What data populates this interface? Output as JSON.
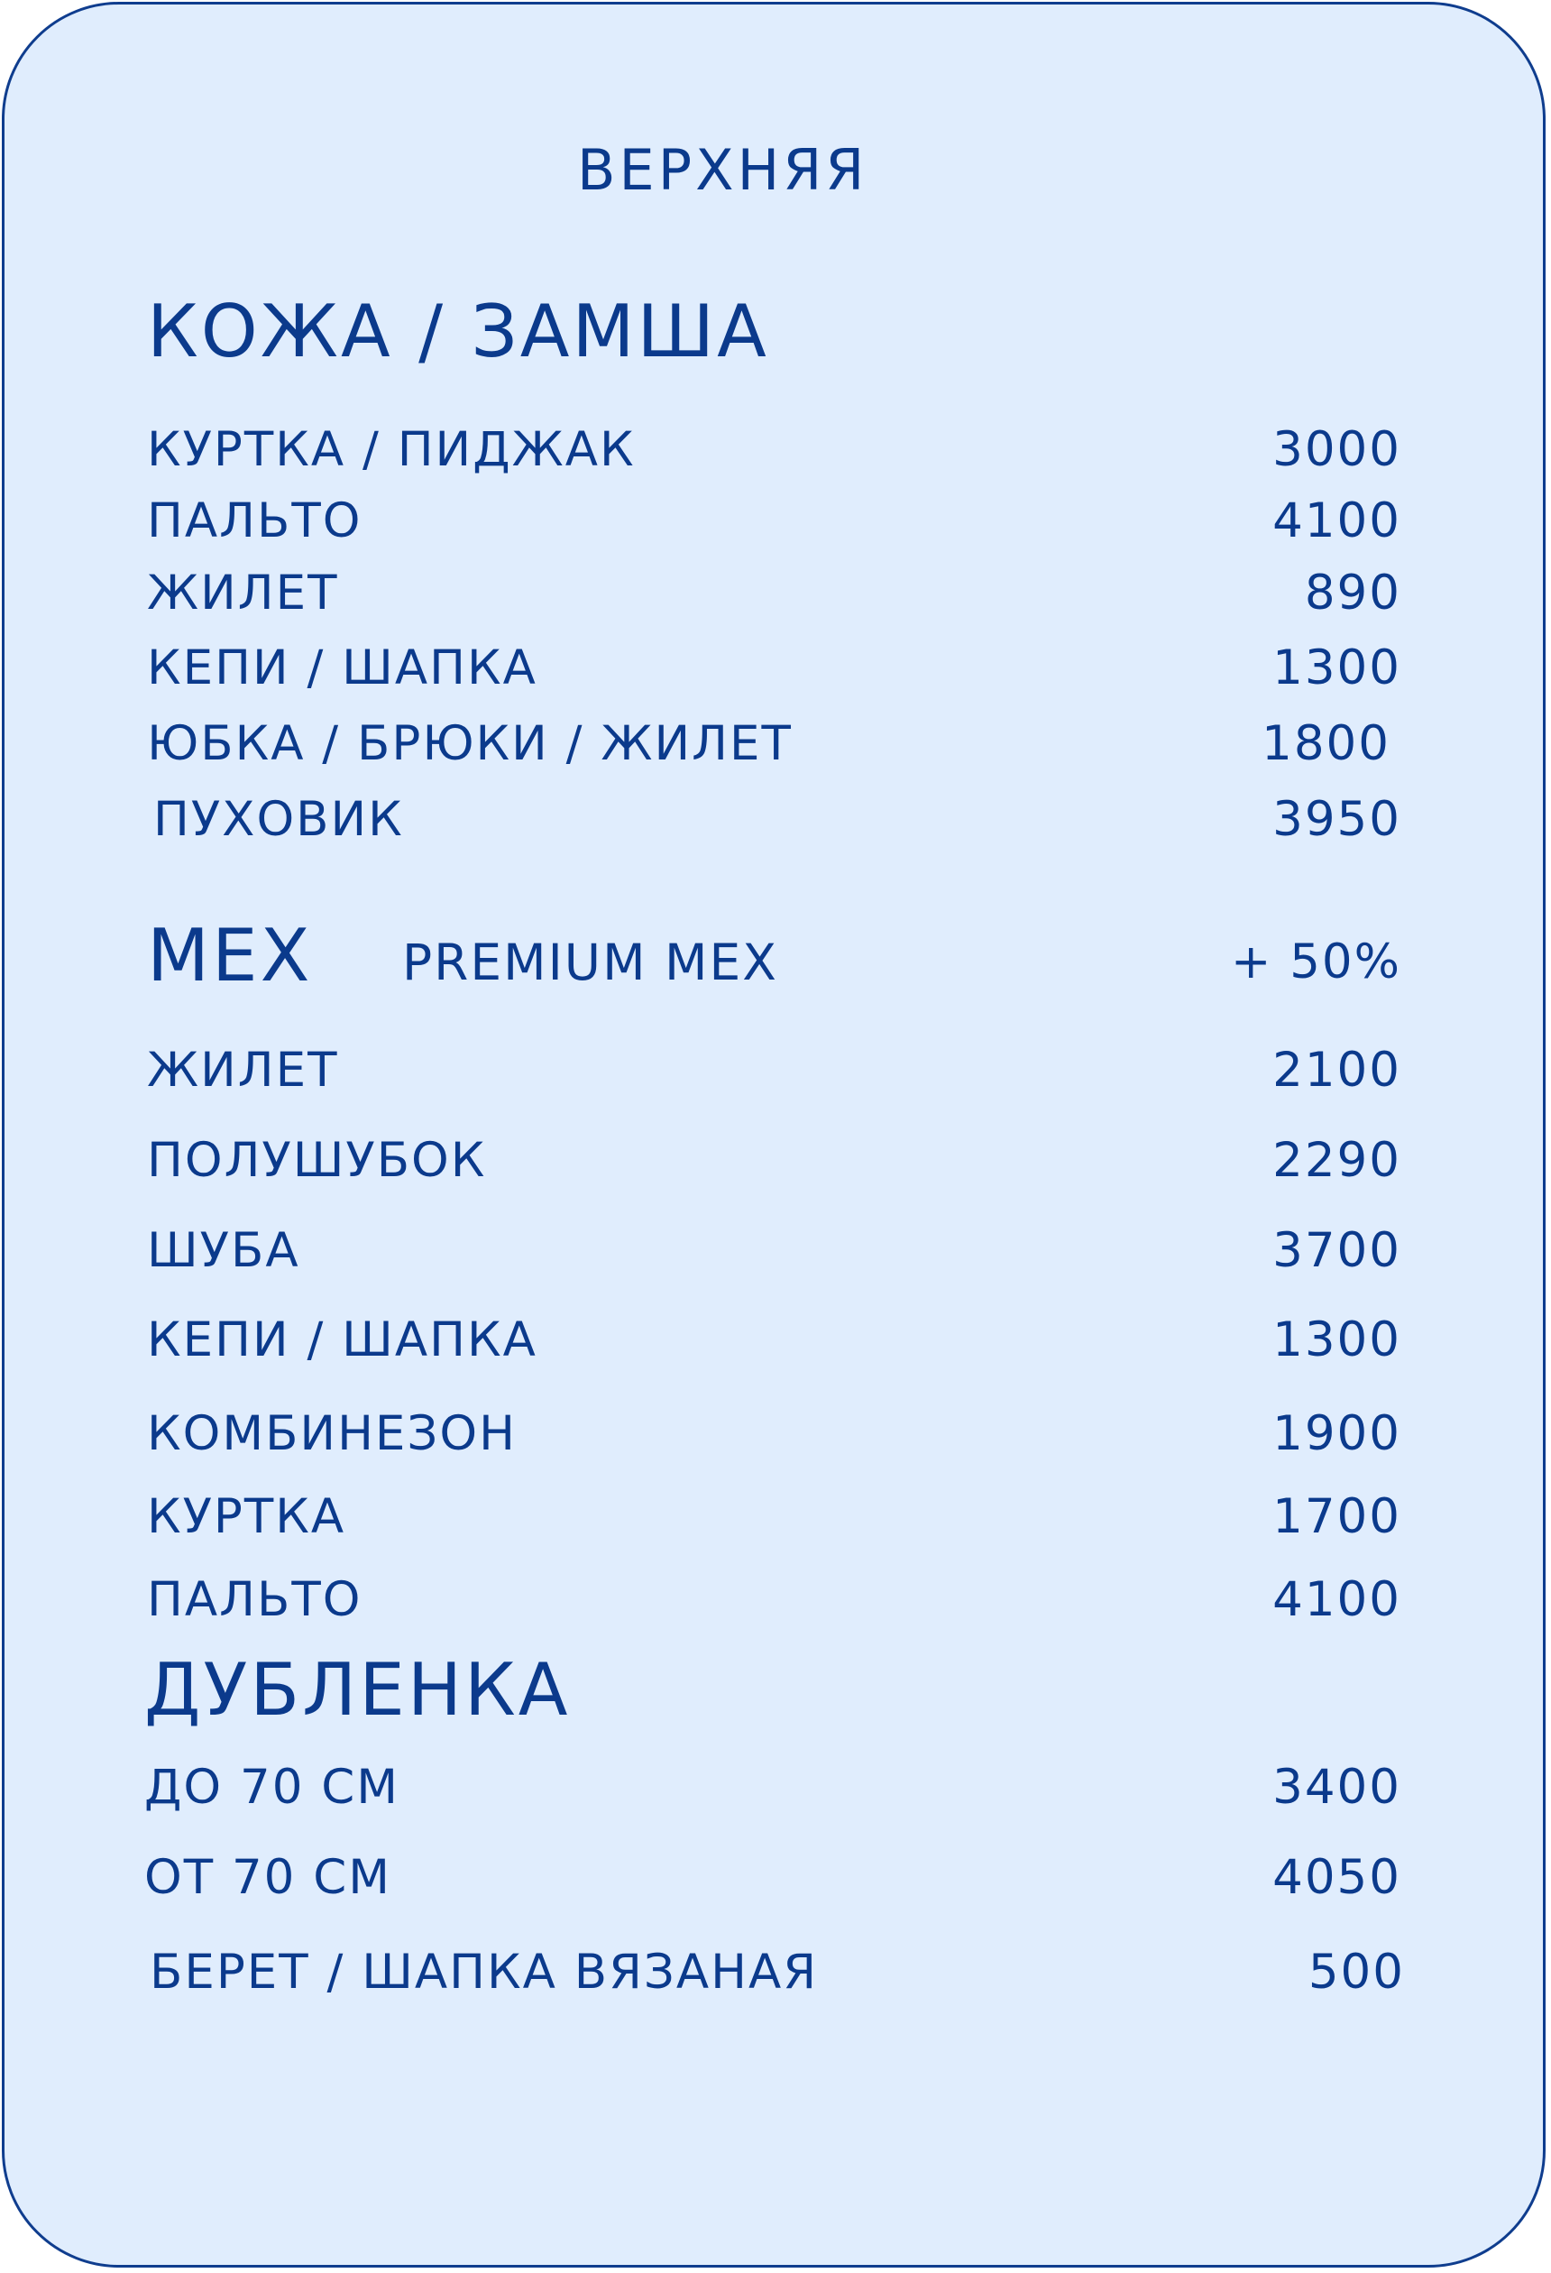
{
  "title": "ВЕРХНЯЯ",
  "leather": {
    "heading": "КОЖА / ЗАМША",
    "items": [
      {
        "name": "КУРТКА / ПИДЖАК",
        "price": "3000"
      },
      {
        "name": "ПАЛЬТО",
        "price": "4100"
      },
      {
        "name": "ЖИЛЕТ",
        "price": "890"
      },
      {
        "name": "КЕПИ / ШАПКА",
        "price": "1300"
      },
      {
        "name": "ЮБКА / БРЮКИ / ЖИЛЕТ",
        "price": "1800"
      },
      {
        "name": "ПУХОВИК",
        "price": "3950"
      }
    ]
  },
  "fur": {
    "heading": "МЕХ",
    "premium_label": "PREMIUM МЕХ",
    "premium_value": "+ 50%",
    "items": [
      {
        "name": "ЖИЛЕТ",
        "price": "2100"
      },
      {
        "name": "ПОЛУШУБОК",
        "price": "2290"
      },
      {
        "name": "ШУБА",
        "price": "3700"
      },
      {
        "name": "КЕПИ / ШАПКА",
        "price": "1300"
      },
      {
        "name": "КОМБИНЕЗОН",
        "price": "1900"
      },
      {
        "name": "КУРТКА",
        "price": "1700"
      },
      {
        "name": "ПАЛЬТО",
        "price": "4100"
      }
    ]
  },
  "sheepskin": {
    "heading": "ДУБЛЕНКА",
    "items": [
      {
        "name": "ДО 70 СМ",
        "price": "3400"
      },
      {
        "name": "ОТ 70 СМ",
        "price": "4050"
      },
      {
        "name": "БЕРЕТ / ШАПКА ВЯЗАНАЯ",
        "price": "500"
      }
    ]
  },
  "colors": {
    "background": "#e0edfd",
    "text": "#0b3a8c",
    "border": "#0f3d8e"
  }
}
